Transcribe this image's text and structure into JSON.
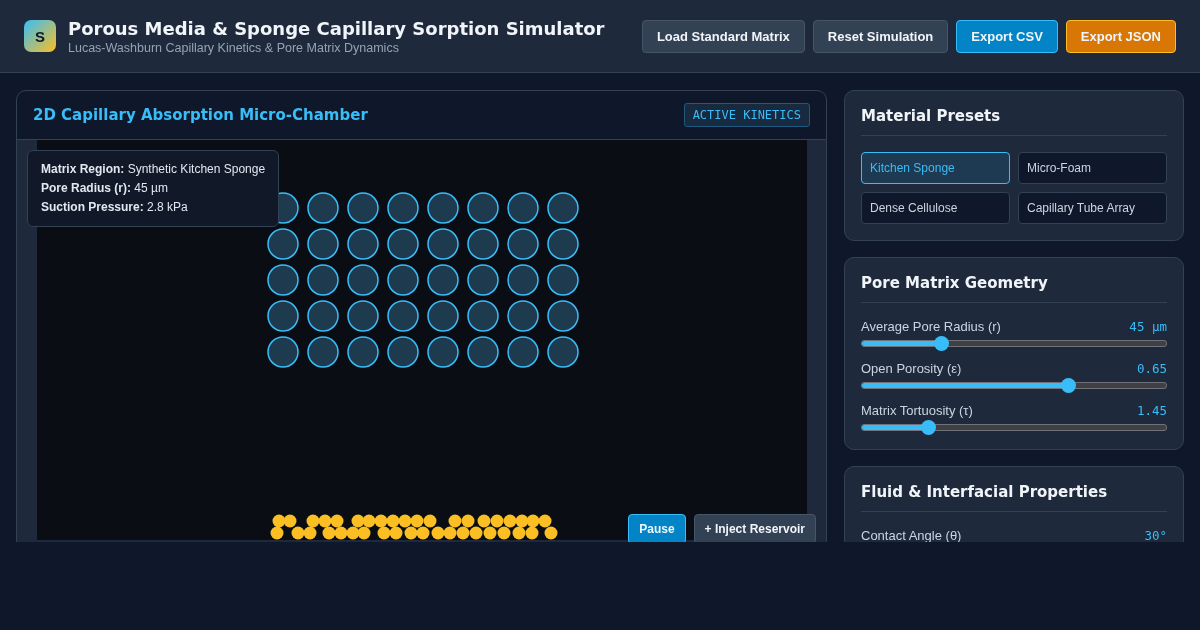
{
  "app": {
    "logo": "S",
    "title": "Porous Media & Sponge Capillary Sorption Simulator",
    "subtitle": "Lucas-Washburn Capillary Kinetics & Pore Matrix Dynamics"
  },
  "header_buttons": [
    {
      "label": "Load Standard Matrix",
      "kind": "neutral"
    },
    {
      "label": "Reset Simulation",
      "kind": "neutral"
    },
    {
      "label": "Export CSV",
      "kind": "primary"
    },
    {
      "label": "Export JSON",
      "kind": "accent"
    }
  ],
  "chamber": {
    "title": "2D Capillary Absorption Micro-Chamber",
    "badge": "ACTIVE KINETICS",
    "tooltip": [
      {
        "label": "Matrix Region:",
        "value": "Synthetic Kitchen Sponge"
      },
      {
        "label": "Pore Radius (r):",
        "value": "45 µm"
      },
      {
        "label": "Suction Pressure:",
        "value": "2.8 kPa"
      }
    ],
    "controls": [
      {
        "label": "Pause",
        "kind": "primary"
      },
      {
        "label": "+ Inject Reservoir",
        "kind": "neutral"
      }
    ]
  },
  "presets": {
    "title": "Material Presets",
    "items": [
      {
        "label": "Kitchen Sponge",
        "selected": true
      },
      {
        "label": "Micro-Foam",
        "selected": false
      },
      {
        "label": "Dense Cellulose",
        "selected": false
      },
      {
        "label": "Capillary Tube Array",
        "selected": false
      }
    ]
  },
  "geometry": {
    "title": "Pore Matrix Geometry",
    "sliders": [
      {
        "label": "Average Pore Radius (r)",
        "reading": "45 μm",
        "level": 0.26
      },
      {
        "label": "Open Porosity (ε)",
        "reading": "0.65",
        "level": 0.68
      },
      {
        "label": "Matrix Tortuosity (τ)",
        "reading": "1.45",
        "level": 0.22
      }
    ]
  },
  "fluid": {
    "title": "Fluid & Interfacial Properties",
    "sliders": [
      {
        "label": "Contact Angle (θ)",
        "reading": "30°"
      }
    ]
  }
}
